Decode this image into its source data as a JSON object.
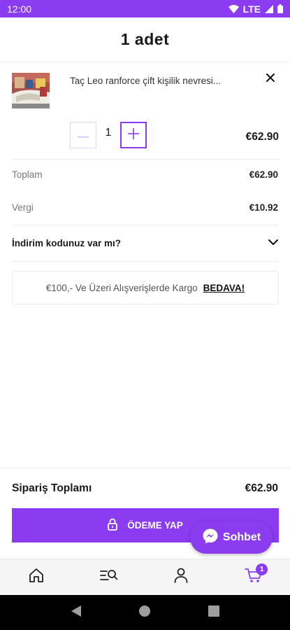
{
  "status_bar": {
    "time": "12:00",
    "network": "LTE"
  },
  "header": {
    "title": "1 adet"
  },
  "cart_item": {
    "name": "Taç Leo ranforce çift kişilik nevresi...",
    "quantity": "1",
    "price": "€62.90",
    "decrement_symbol": "−",
    "increment_symbol": "+"
  },
  "summary": {
    "total_label": "Toplam",
    "total_value": "€62.90",
    "tax_label": "Vergi",
    "tax_value": "€10.92"
  },
  "discount": {
    "label": "İndirim kodunuz var mı?"
  },
  "shipping_banner": {
    "text": "€100,- Ve Üzeri Alışverişlerde Kargo",
    "strong": "BEDAVA!"
  },
  "order_total": {
    "label": "Sipariş Toplamı",
    "value": "€62.90"
  },
  "checkout": {
    "label": "ÖDEME YAP"
  },
  "chat": {
    "label": "Sohbet"
  },
  "bottom_nav": {
    "cart_badge": "1"
  },
  "icons": {
    "wifi": "wifi-icon",
    "signal": "signal-icon",
    "battery": "battery-icon",
    "close": "close-icon",
    "chevron": "chevron-down-icon",
    "lock": "lock-icon",
    "messenger": "messenger-icon",
    "home": "home-icon",
    "search_list": "list-search-icon",
    "user": "user-icon",
    "cart": "cart-icon"
  },
  "colors": {
    "accent": "#8b3cf0",
    "accent_light": "#e2d4fb",
    "nav_bg": "#f6f5f5",
    "system_nav_bg": "#000000"
  }
}
